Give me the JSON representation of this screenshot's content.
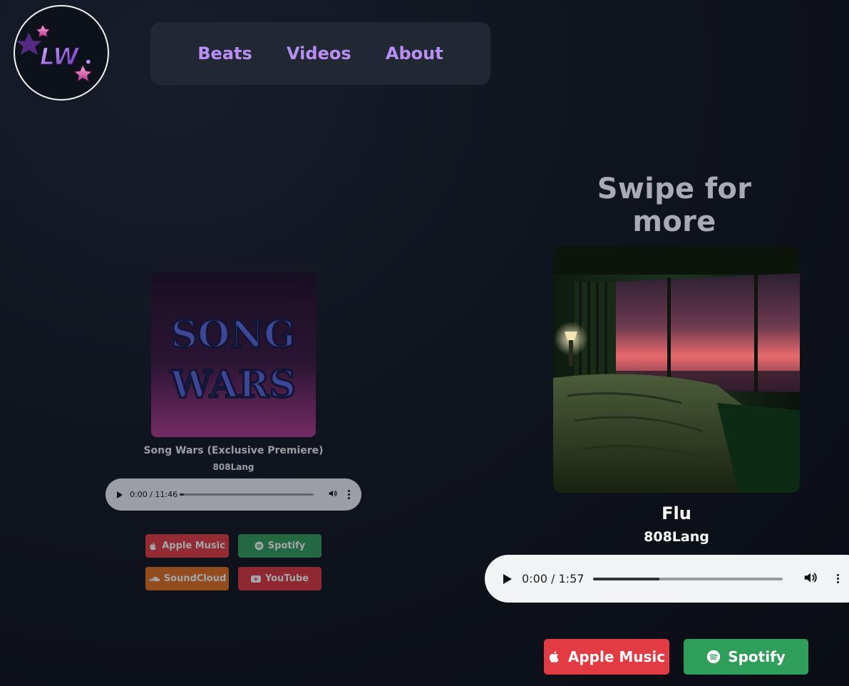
{
  "nav": {
    "logo_text": "LW",
    "items": [
      {
        "label": "Beats"
      },
      {
        "label": "Videos"
      },
      {
        "label": "About"
      }
    ]
  },
  "swipe_text": "Swipe for more",
  "left_track": {
    "cover_text_line1": "SONG",
    "cover_text_line2": "WARS",
    "title": "Song Wars (Exclusive Premiere)",
    "artist": "808Lang",
    "player": {
      "time": "0:00 / 11:46",
      "progress_fraction": 0.03
    },
    "links": [
      {
        "label": "Apple Music",
        "icon": "apple-icon",
        "color": "#e23b43"
      },
      {
        "label": "Spotify",
        "icon": "spotify-icon",
        "color": "#2f9e5a"
      },
      {
        "label": "SoundCloud",
        "icon": "soundcloud-icon",
        "color": "#e3701f"
      },
      {
        "label": "YouTube",
        "icon": "youtube-icon",
        "color": "#e0373f"
      }
    ]
  },
  "right_track": {
    "title": "Flu",
    "artist": "808Lang",
    "player": {
      "time": "0:00 / 1:57",
      "progress_fraction": 0.35
    },
    "links": [
      {
        "label": "Apple Music",
        "icon": "apple-icon",
        "color": "#e23b43"
      },
      {
        "label": "Spotify",
        "icon": "spotify-icon",
        "color": "#2f9e5a"
      }
    ]
  },
  "colors": {
    "nav_link": "#b890f4",
    "nav_bg": "#222734",
    "player_bg": "#f1f3f4"
  }
}
